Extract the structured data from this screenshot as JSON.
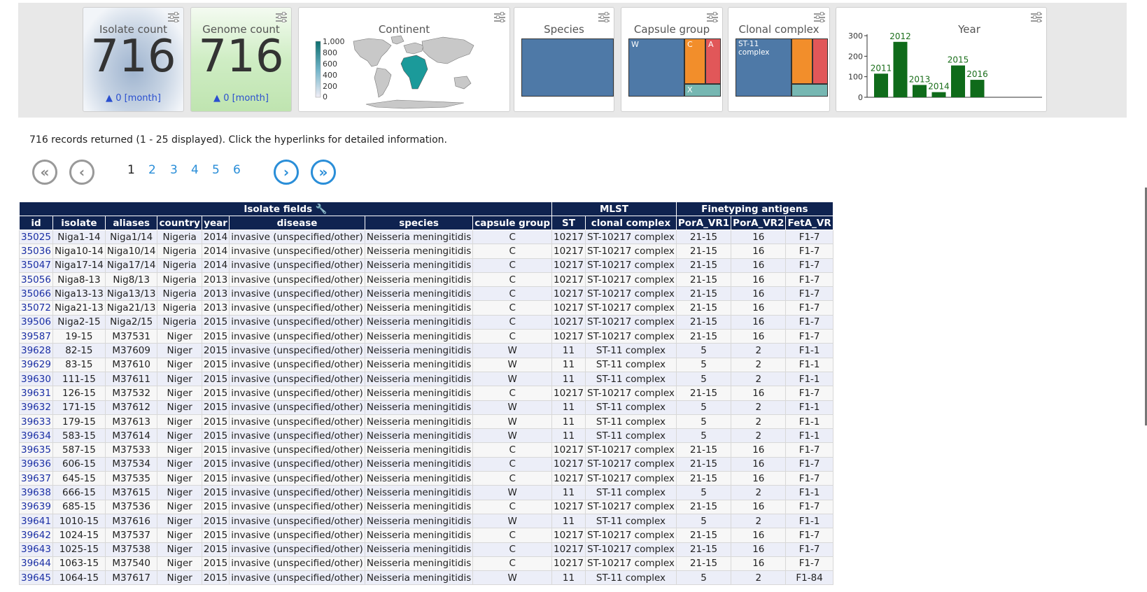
{
  "dashboard": {
    "isolate_count": {
      "title": "Isolate count",
      "value": "716",
      "delta": "0 [month]"
    },
    "genome_count": {
      "title": "Genome count",
      "value": "716",
      "delta": "0 [month]"
    },
    "continent": {
      "title": "Continent",
      "legend_ticks": [
        "1,000",
        "800",
        "600",
        "400",
        "200",
        "0"
      ]
    },
    "species": {
      "title": "Species"
    },
    "capsule_group": {
      "title": "Capsule group",
      "labels": [
        "W",
        "C",
        "A",
        "X"
      ]
    },
    "clonal_complex": {
      "title": "Clonal complex",
      "labels": [
        "ST-11 complex"
      ]
    },
    "year": {
      "title": "Year",
      "chart_data": {
        "type": "bar",
        "categories": [
          "2011",
          "2012",
          "2013",
          "2014",
          "2015",
          "2016"
        ],
        "values": [
          115,
          270,
          60,
          25,
          155,
          85
        ],
        "ylim": [
          0,
          300
        ],
        "yticks": [
          "0",
          "100",
          "200",
          "300"
        ],
        "color": "#0f6b1a"
      }
    }
  },
  "records_summary": "716 records returned (1 - 25 displayed). Click the hyperlinks for detailed information.",
  "pager": {
    "first": "«",
    "prev": "‹",
    "next": "›",
    "last": "»",
    "pages": [
      "1",
      "2",
      "3",
      "4",
      "5",
      "6"
    ],
    "current": "1"
  },
  "table": {
    "groups": [
      {
        "label": "Isolate fields 🔧",
        "span": 8
      },
      {
        "label": "MLST",
        "span": 2
      },
      {
        "label": "Finetyping antigens",
        "span": 3
      }
    ],
    "columns": [
      "id",
      "isolate",
      "aliases",
      "country",
      "year",
      "disease",
      "species",
      "capsule group",
      "ST",
      "clonal complex",
      "PorA_VR1",
      "PorA_VR2",
      "FetA_VR"
    ],
    "rows": [
      [
        "35025",
        "Niga1-14",
        "Niga1/14",
        "Nigeria",
        "2014",
        "invasive (unspecified/other)",
        "Neisseria meningitidis",
        "C",
        "10217",
        "ST-10217 complex",
        "21-15",
        "16",
        "F1-7"
      ],
      [
        "35036",
        "Niga10-14",
        "Niga10/14",
        "Nigeria",
        "2014",
        "invasive (unspecified/other)",
        "Neisseria meningitidis",
        "C",
        "10217",
        "ST-10217 complex",
        "21-15",
        "16",
        "F1-7"
      ],
      [
        "35047",
        "Niga17-14",
        "Niga17/14",
        "Nigeria",
        "2014",
        "invasive (unspecified/other)",
        "Neisseria meningitidis",
        "C",
        "10217",
        "ST-10217 complex",
        "21-15",
        "16",
        "F1-7"
      ],
      [
        "35056",
        "Niga8-13",
        "Nig8/13",
        "Nigeria",
        "2013",
        "invasive (unspecified/other)",
        "Neisseria meningitidis",
        "C",
        "10217",
        "ST-10217 complex",
        "21-15",
        "16",
        "F1-7"
      ],
      [
        "35066",
        "Niga13-13",
        "Niga13/13",
        "Nigeria",
        "2013",
        "invasive (unspecified/other)",
        "Neisseria meningitidis",
        "C",
        "10217",
        "ST-10217 complex",
        "21-15",
        "16",
        "F1-7"
      ],
      [
        "35072",
        "Niga21-13",
        "Niga21/13",
        "Nigeria",
        "2013",
        "invasive (unspecified/other)",
        "Neisseria meningitidis",
        "C",
        "10217",
        "ST-10217 complex",
        "21-15",
        "16",
        "F1-7"
      ],
      [
        "39506",
        "Niga2-15",
        "Niga2/15",
        "Nigeria",
        "2015",
        "invasive (unspecified/other)",
        "Neisseria meningitidis",
        "C",
        "10217",
        "ST-10217 complex",
        "21-15",
        "16",
        "F1-7"
      ],
      [
        "39587",
        "19-15",
        "M37531",
        "Niger",
        "2015",
        "invasive (unspecified/other)",
        "Neisseria meningitidis",
        "C",
        "10217",
        "ST-10217 complex",
        "21-15",
        "16",
        "F1-7"
      ],
      [
        "39628",
        "82-15",
        "M37609",
        "Niger",
        "2015",
        "invasive (unspecified/other)",
        "Neisseria meningitidis",
        "W",
        "11",
        "ST-11 complex",
        "5",
        "2",
        "F1-1"
      ],
      [
        "39629",
        "83-15",
        "M37610",
        "Niger",
        "2015",
        "invasive (unspecified/other)",
        "Neisseria meningitidis",
        "W",
        "11",
        "ST-11 complex",
        "5",
        "2",
        "F1-1"
      ],
      [
        "39630",
        "111-15",
        "M37611",
        "Niger",
        "2015",
        "invasive (unspecified/other)",
        "Neisseria meningitidis",
        "W",
        "11",
        "ST-11 complex",
        "5",
        "2",
        "F1-1"
      ],
      [
        "39631",
        "126-15",
        "M37532",
        "Niger",
        "2015",
        "invasive (unspecified/other)",
        "Neisseria meningitidis",
        "C",
        "10217",
        "ST-10217 complex",
        "21-15",
        "16",
        "F1-7"
      ],
      [
        "39632",
        "171-15",
        "M37612",
        "Niger",
        "2015",
        "invasive (unspecified/other)",
        "Neisseria meningitidis",
        "W",
        "11",
        "ST-11 complex",
        "5",
        "2",
        "F1-1"
      ],
      [
        "39633",
        "179-15",
        "M37613",
        "Niger",
        "2015",
        "invasive (unspecified/other)",
        "Neisseria meningitidis",
        "W",
        "11",
        "ST-11 complex",
        "5",
        "2",
        "F1-1"
      ],
      [
        "39634",
        "583-15",
        "M37614",
        "Niger",
        "2015",
        "invasive (unspecified/other)",
        "Neisseria meningitidis",
        "W",
        "11",
        "ST-11 complex",
        "5",
        "2",
        "F1-1"
      ],
      [
        "39635",
        "587-15",
        "M37533",
        "Niger",
        "2015",
        "invasive (unspecified/other)",
        "Neisseria meningitidis",
        "C",
        "10217",
        "ST-10217 complex",
        "21-15",
        "16",
        "F1-7"
      ],
      [
        "39636",
        "606-15",
        "M37534",
        "Niger",
        "2015",
        "invasive (unspecified/other)",
        "Neisseria meningitidis",
        "C",
        "10217",
        "ST-10217 complex",
        "21-15",
        "16",
        "F1-7"
      ],
      [
        "39637",
        "645-15",
        "M37535",
        "Niger",
        "2015",
        "invasive (unspecified/other)",
        "Neisseria meningitidis",
        "C",
        "10217",
        "ST-10217 complex",
        "21-15",
        "16",
        "F1-7"
      ],
      [
        "39638",
        "666-15",
        "M37615",
        "Niger",
        "2015",
        "invasive (unspecified/other)",
        "Neisseria meningitidis",
        "W",
        "11",
        "ST-11 complex",
        "5",
        "2",
        "F1-1"
      ],
      [
        "39639",
        "685-15",
        "M37536",
        "Niger",
        "2015",
        "invasive (unspecified/other)",
        "Neisseria meningitidis",
        "C",
        "10217",
        "ST-10217 complex",
        "21-15",
        "16",
        "F1-7"
      ],
      [
        "39641",
        "1010-15",
        "M37616",
        "Niger",
        "2015",
        "invasive (unspecified/other)",
        "Neisseria meningitidis",
        "W",
        "11",
        "ST-11 complex",
        "5",
        "2",
        "F1-1"
      ],
      [
        "39642",
        "1024-15",
        "M37537",
        "Niger",
        "2015",
        "invasive (unspecified/other)",
        "Neisseria meningitidis",
        "C",
        "10217",
        "ST-10217 complex",
        "21-15",
        "16",
        "F1-7"
      ],
      [
        "39643",
        "1025-15",
        "M37538",
        "Niger",
        "2015",
        "invasive (unspecified/other)",
        "Neisseria meningitidis",
        "C",
        "10217",
        "ST-10217 complex",
        "21-15",
        "16",
        "F1-7"
      ],
      [
        "39644",
        "1063-15",
        "M37540",
        "Niger",
        "2015",
        "invasive (unspecified/other)",
        "Neisseria meningitidis",
        "C",
        "10217",
        "ST-10217 complex",
        "21-15",
        "16",
        "F1-7"
      ],
      [
        "39645",
        "1064-15",
        "M37617",
        "Niger",
        "2015",
        "invasive (unspecified/other)",
        "Neisseria meningitidis",
        "W",
        "11",
        "ST-11 complex",
        "5",
        "2",
        "F1-84"
      ]
    ]
  },
  "colors": {
    "header_bg": "#0f2350",
    "link": "#1b2fa5",
    "pager_blue": "#2a8ed8",
    "treemap_blue": "#4e79a7",
    "treemap_orange": "#f28e2b",
    "treemap_red": "#e15759",
    "treemap_teal": "#76b7b2",
    "map_teal": "#1b8f8f",
    "bar_green": "#0f6b1a"
  }
}
